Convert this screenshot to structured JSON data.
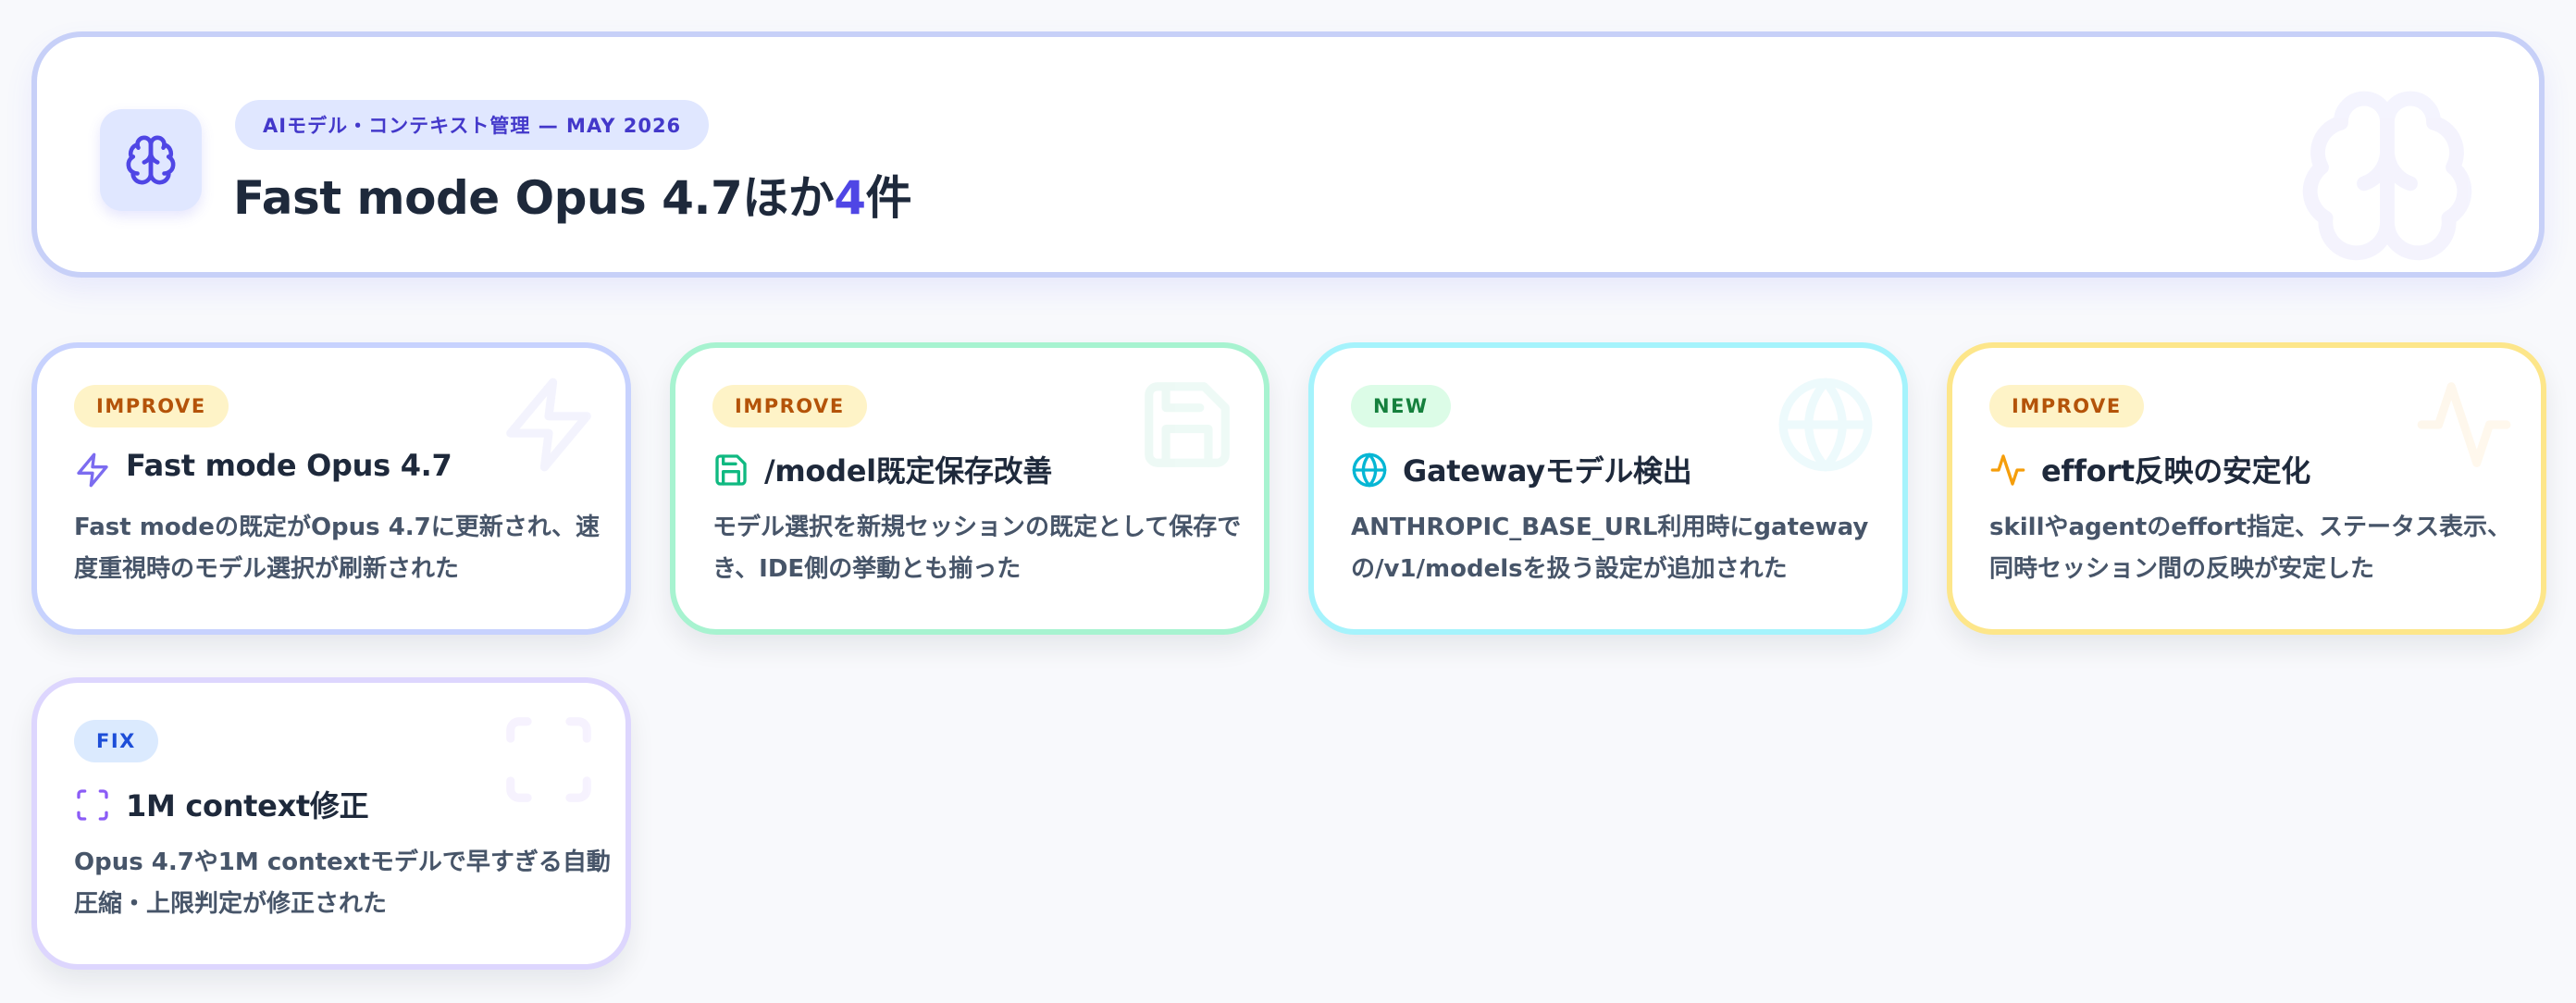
{
  "header": {
    "badge": "AIモデル・コンテキスト管理 — MAY 2026",
    "title_prefix": "Fast mode Opus 4.7ほか",
    "title_count": "4",
    "title_suffix": "件",
    "icon": "brain-icon"
  },
  "cards": [
    {
      "tag": "IMPROVE",
      "icon": "zap-icon",
      "title": "Fast mode Opus 4.7",
      "desc": "Fast modeの既定がOpus 4.7に更新され、速度重視時のモデル選択が刷新された"
    },
    {
      "tag": "IMPROVE",
      "icon": "save-icon",
      "title": "/model既定保存改善",
      "desc": "モデル選択を新規セッションの既定として保存でき、IDE側の挙動とも揃った"
    },
    {
      "tag": "NEW",
      "icon": "globe-icon",
      "title": "Gatewayモデル検出",
      "desc": "ANTHROPIC_BASE_URL利用時にgatewayの/v1/modelsを扱う設定が追加された"
    },
    {
      "tag": "IMPROVE",
      "icon": "activity-icon",
      "title": "effort反映の安定化",
      "desc": "skillやagentのeffort指定、ステータス表示、同時セッション間の反映が安定した"
    },
    {
      "tag": "FIX",
      "icon": "scan-icon",
      "title": "1M context修正",
      "desc": "Opus 4.7や1M contextモデルで早すぎる自動圧縮・上限判定が修正された"
    }
  ],
  "colors": {
    "accent": "#4f46e5",
    "improve": "#b45309",
    "new": "#15803d",
    "fix": "#1d4ed8",
    "zap": "#7c6cf0",
    "save": "#10b981",
    "globe": "#06b6d4",
    "activity": "#f59e0b",
    "scan": "#8b5cf6"
  }
}
